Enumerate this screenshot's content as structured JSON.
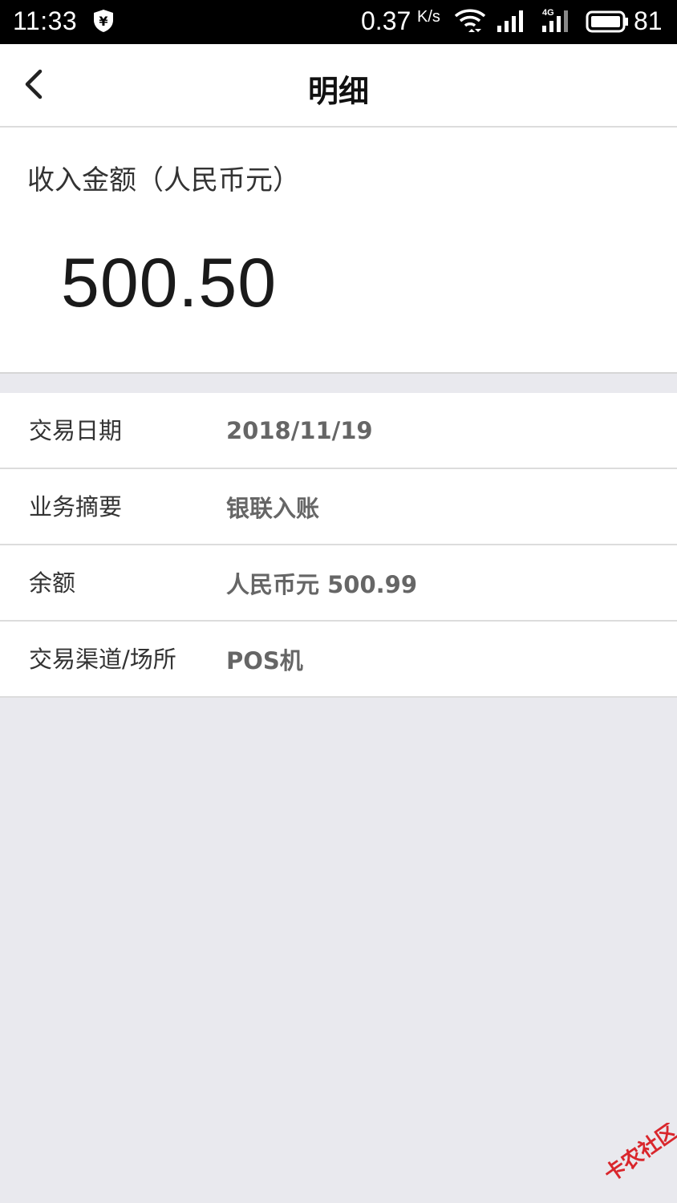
{
  "status_bar": {
    "time": "11:33",
    "speed": "0.37",
    "speed_unit": "K/s",
    "network": "4G",
    "battery": "81",
    "icons": [
      "shield-yen-icon",
      "wifi-icon",
      "signal-icon",
      "signal-4g-icon",
      "battery-icon"
    ]
  },
  "nav": {
    "title": "明细",
    "back_icon": "chevron-left-icon"
  },
  "amount": {
    "label": "收入金额（人民币元）",
    "value": "500.50"
  },
  "details": [
    {
      "key": "交易日期",
      "value": "2018/11/19"
    },
    {
      "key": "业务摘要",
      "value": "银联入账"
    },
    {
      "key": "余额",
      "value": "人民币元 500.99"
    },
    {
      "key": "交易渠道/场所",
      "value": "POS机"
    }
  ],
  "watermark": {
    "text": "卡农社区"
  },
  "colors": {
    "background": "#e9e9ee",
    "card": "#ffffff",
    "value_text": "#666666",
    "watermark": "#d9262c"
  }
}
